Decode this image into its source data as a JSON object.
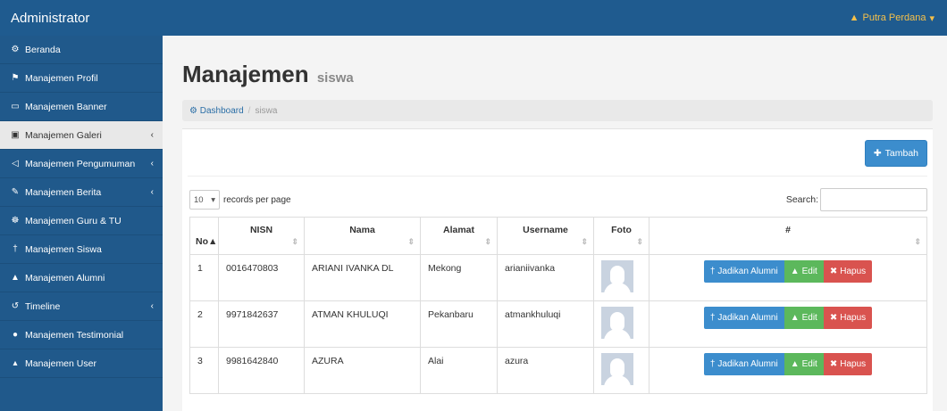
{
  "header": {
    "brand": "Administrator",
    "user": "Putra Perdana"
  },
  "sidebar": {
    "items": [
      {
        "label": "Beranda",
        "icon": "dashboard-icon",
        "glyph": "⚙",
        "chev": false
      },
      {
        "label": "Manajemen Profil",
        "icon": "flag-icon",
        "glyph": "⚑",
        "chev": false
      },
      {
        "label": "Manajemen Banner",
        "icon": "monitor-icon",
        "glyph": "▭",
        "chev": false
      },
      {
        "label": "Manajemen Galeri",
        "icon": "image-icon",
        "glyph": "▣",
        "chev": true,
        "active": true
      },
      {
        "label": "Manajemen Pengumuman",
        "icon": "volume-icon",
        "glyph": "◁",
        "chev": true
      },
      {
        "label": "Manajemen Berita",
        "icon": "pencil-icon",
        "glyph": "✎",
        "chev": true
      },
      {
        "label": "Manajemen Guru & TU",
        "icon": "users-icon",
        "glyph": "☸",
        "chev": false
      },
      {
        "label": "Manajemen Siswa",
        "icon": "user-icon",
        "glyph": "†",
        "chev": false
      },
      {
        "label": "Manajemen Alumni",
        "icon": "graduation-icon",
        "glyph": "▲",
        "chev": false
      },
      {
        "label": "Timeline",
        "icon": "history-icon",
        "glyph": "↺",
        "chev": true
      },
      {
        "label": "Manajemen Testimonial",
        "icon": "comments-icon",
        "glyph": "●",
        "chev": false
      },
      {
        "label": "Manajemen User",
        "icon": "user-admin-icon",
        "glyph": "▴",
        "chev": false
      }
    ]
  },
  "page": {
    "title": "Manajemen",
    "subtitle": "siswa"
  },
  "breadcrumb": {
    "home": "Dashboard",
    "current": "siswa"
  },
  "toolbar": {
    "add_label": "Tambah"
  },
  "datatable": {
    "page_length": "10",
    "length_label": "records per page",
    "search_label": "Search:"
  },
  "table": {
    "headers": {
      "no": "No",
      "nisn": "NISN",
      "nama": "Nama",
      "alamat": "Alamat",
      "username": "Username",
      "foto": "Foto",
      "actions": "#"
    },
    "rows": [
      {
        "no": "1",
        "nisn": "0016470803",
        "nama": "ARIANI IVANKA DL",
        "alamat": "Mekong",
        "username": "arianiivanka"
      },
      {
        "no": "2",
        "nisn": "9971842637",
        "nama": "ATMAN KHULUQI",
        "alamat": "Pekanbaru",
        "username": "atmankhuluqi"
      },
      {
        "no": "3",
        "nisn": "9981642840",
        "nama": "AZURA",
        "alamat": "Alai",
        "username": "azura"
      }
    ],
    "actions": {
      "alumni": "Jadikan Alumni",
      "edit": "Edit",
      "hapus": "Hapus"
    }
  },
  "colors": {
    "header": "#1f5b8f",
    "sidebar": "#20598b",
    "primary": "#3c8dcd",
    "success": "#5cb85c",
    "danger": "#d9534f",
    "user_accent": "#f5c04a"
  }
}
